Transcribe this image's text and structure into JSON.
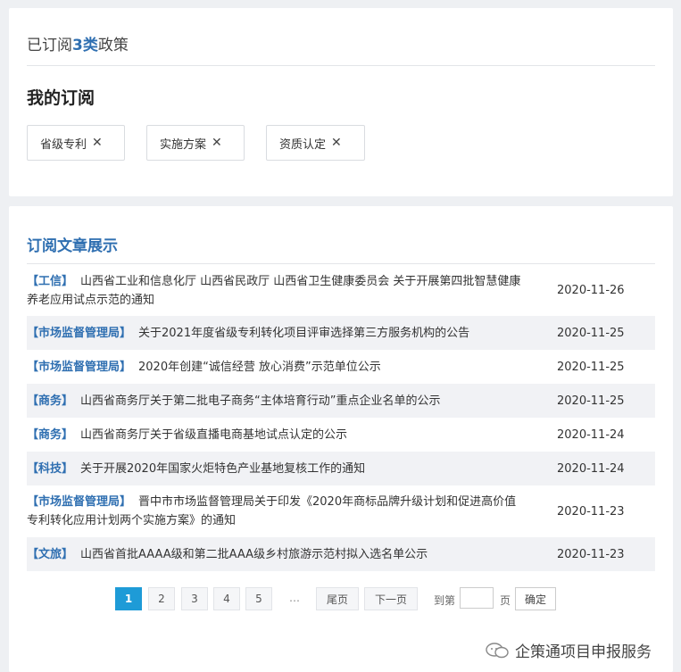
{
  "summary": {
    "prefix": "已订阅",
    "count": "3类",
    "suffix": "政策"
  },
  "my_subscriptions": {
    "title": "我的订阅",
    "tags": [
      "省级专利",
      "实施方案",
      "资质认定"
    ],
    "remove_glyph": "✕"
  },
  "articles": {
    "title": "订阅文章展示",
    "items": [
      {
        "category": "【工信】",
        "title": "山西省工业和信息化厅 山西省民政厅 山西省卫生健康委员会 关于开展第四批智慧健康养老应用试点示范的通知",
        "date": "2020-11-26"
      },
      {
        "category": "【市场监督管理局】",
        "title": "关于2021年度省级专利转化项目评审选择第三方服务机构的公告",
        "date": "2020-11-25"
      },
      {
        "category": "【市场监督管理局】",
        "title": "2020年创建“诚信经营 放心消费”示范单位公示",
        "date": "2020-11-25"
      },
      {
        "category": "【商务】",
        "title": "山西省商务厅关于第二批电子商务“主体培育行动”重点企业名单的公示",
        "date": "2020-11-25"
      },
      {
        "category": "【商务】",
        "title": "山西省商务厅关于省级直播电商基地试点认定的公示",
        "date": "2020-11-24"
      },
      {
        "category": "【科技】",
        "title": "关于开展2020年国家火炬特色产业基地复核工作的通知",
        "date": "2020-11-24"
      },
      {
        "category": "【市场监督管理局】",
        "title": "晋中市市场监督管理局关于印发《2020年商标品牌升级计划和促进高价值专利转化应用计划两个实施方案》的通知",
        "date": "2020-11-23"
      },
      {
        "category": "【文旅】",
        "title": "山西省首批AAAA级和第二批AAA级乡村旅游示范村拟入选名单公示",
        "date": "2020-11-23"
      }
    ]
  },
  "pagination": {
    "pages": [
      "1",
      "2",
      "3",
      "4",
      "5"
    ],
    "current": "1",
    "ellipsis": "…",
    "last_label": "尾页",
    "next_label": "下一页",
    "goto_prefix": "到第",
    "goto_suffix": "页",
    "confirm_label": "确定"
  },
  "watermark": {
    "text": "企策通项目申报服务",
    "icon": "wechat-icon"
  },
  "colors": {
    "accent": "#2f6fb1",
    "active_page": "#1e9bd7",
    "background": "#eef0f3"
  }
}
